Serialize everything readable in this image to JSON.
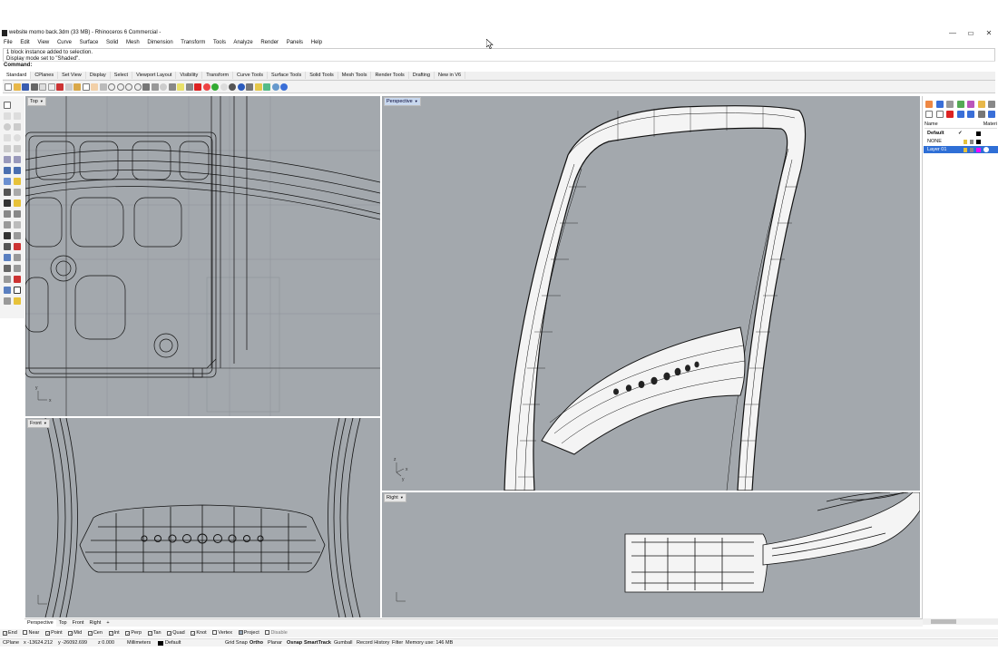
{
  "window": {
    "title": "website momo back.3dm (33 MB) - Rhinoceros 6 Commercial -",
    "controls": {
      "minimize": "—",
      "maximize": "▭",
      "close": "✕"
    }
  },
  "menu": [
    "File",
    "Edit",
    "View",
    "Curve",
    "Surface",
    "Solid",
    "Mesh",
    "Dimension",
    "Transform",
    "Tools",
    "Analyze",
    "Render",
    "Panels",
    "Help"
  ],
  "command_history": [
    "1 block instance added to selection.",
    "Display mode set to \"Shaded\"."
  ],
  "command_prompt": "Command:",
  "toolbar_tabs": [
    "Standard",
    "CPlanes",
    "Set View",
    "Display",
    "Select",
    "Viewport Layout",
    "Visibility",
    "Transform",
    "Curve Tools",
    "Surface Tools",
    "Solid Tools",
    "Mesh Tools",
    "Render Tools",
    "Drafting",
    "New in V6"
  ],
  "viewports": {
    "top": {
      "label": "Top",
      "axes": [
        "x",
        "y"
      ]
    },
    "perspective": {
      "label": "Perspective",
      "axes": [
        "x",
        "y",
        "z"
      ]
    },
    "front": {
      "label": "Front",
      "axes": [
        "x",
        "z"
      ]
    },
    "right": {
      "label": "Right",
      "axes": [
        "y",
        "z"
      ]
    }
  },
  "viewport_tabs": [
    "Perspective",
    "Top",
    "Front",
    "Right",
    "+"
  ],
  "layers_panel": {
    "columns": {
      "name": "Name",
      "material": "Materi"
    },
    "rows": [
      {
        "name": "Default",
        "check": "✓",
        "color": "#000000",
        "bold": true
      },
      {
        "name": "NONE",
        "check": "",
        "color": "#000000",
        "bold": false
      },
      {
        "name": "Layer 01",
        "check": "",
        "color": "#ff00ff",
        "bold": false,
        "selected": true
      }
    ]
  },
  "osnaps": [
    {
      "label": "End",
      "checked": true
    },
    {
      "label": "Near",
      "checked": false
    },
    {
      "label": "Point",
      "checked": true
    },
    {
      "label": "Mid",
      "checked": true
    },
    {
      "label": "Cen",
      "checked": true
    },
    {
      "label": "Int",
      "checked": true
    },
    {
      "label": "Perp",
      "checked": true
    },
    {
      "label": "Tan",
      "checked": true
    },
    {
      "label": "Quad",
      "checked": true
    },
    {
      "label": "Knot",
      "checked": true
    },
    {
      "label": "Vertex",
      "checked": false
    },
    {
      "label": "Project",
      "checked": false
    },
    {
      "label": "Disable",
      "checked": false
    }
  ],
  "status": {
    "cplane": "CPlane",
    "x": "x -13624.212",
    "y": "y -26092.699",
    "z": "z 0.000",
    "units": "Millimeters",
    "layer": "Default",
    "grid_snap": "Grid Snap",
    "ortho": "Ortho",
    "planar": "Planar",
    "osnap": "Osnap",
    "smarttrack": "SmartTrack",
    "gumball": "Gumball",
    "record_history": "Record History",
    "filter": "Filter",
    "memory": "Memory use: 146 MB"
  },
  "colors": {
    "viewport_bg": "#a3a8ad",
    "selection": "#2f6fd6",
    "wire": "#111111",
    "surface": "#f4f4f4"
  }
}
